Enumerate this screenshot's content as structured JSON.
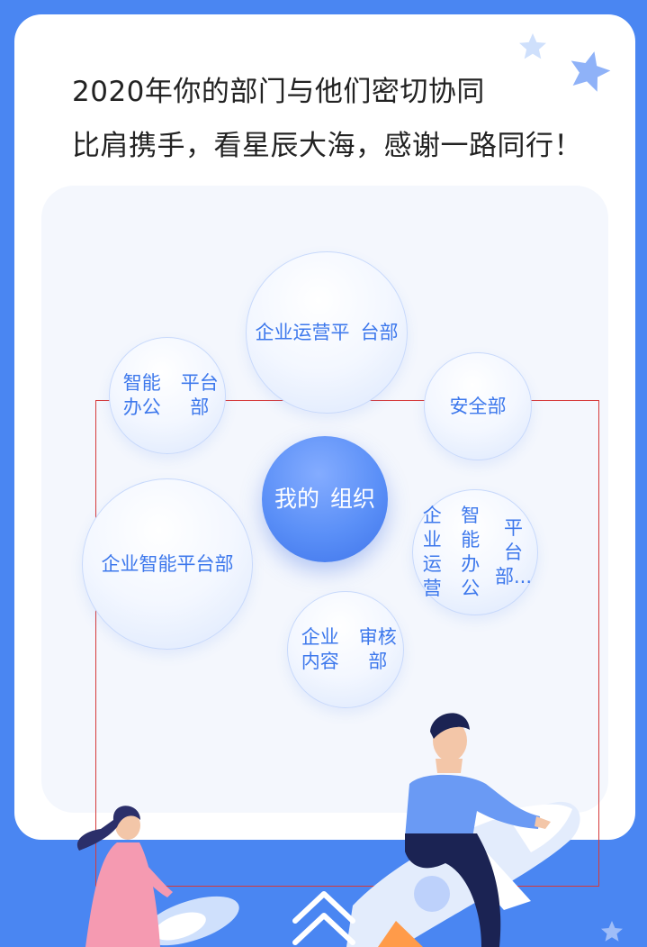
{
  "header": {
    "line1": "2020年你的部门与他们密切协同",
    "line2": "比肩携手，看星辰大海，感谢一路同行！"
  },
  "bubbles": {
    "center": {
      "l1": "我的",
      "l2": "组织"
    },
    "top": {
      "l1": "企业运营平",
      "l2": "台部"
    },
    "left_top": {
      "l1": "智能办公",
      "l2": "平台部"
    },
    "right_top": {
      "l1": "安全部"
    },
    "left_big": {
      "l1": "企业智能平台部"
    },
    "right_mid": {
      "l1": "企业运营",
      "l2": "智能办公",
      "l3": "平台部..."
    },
    "bottom": {
      "l1": "企业内容",
      "l2": "审核部"
    }
  },
  "colors": {
    "background": "#4a86f2",
    "bubble_text": "#3d78ec",
    "center_bubble": "#5a8ff7",
    "highlight_frame": "#d63a3a"
  }
}
